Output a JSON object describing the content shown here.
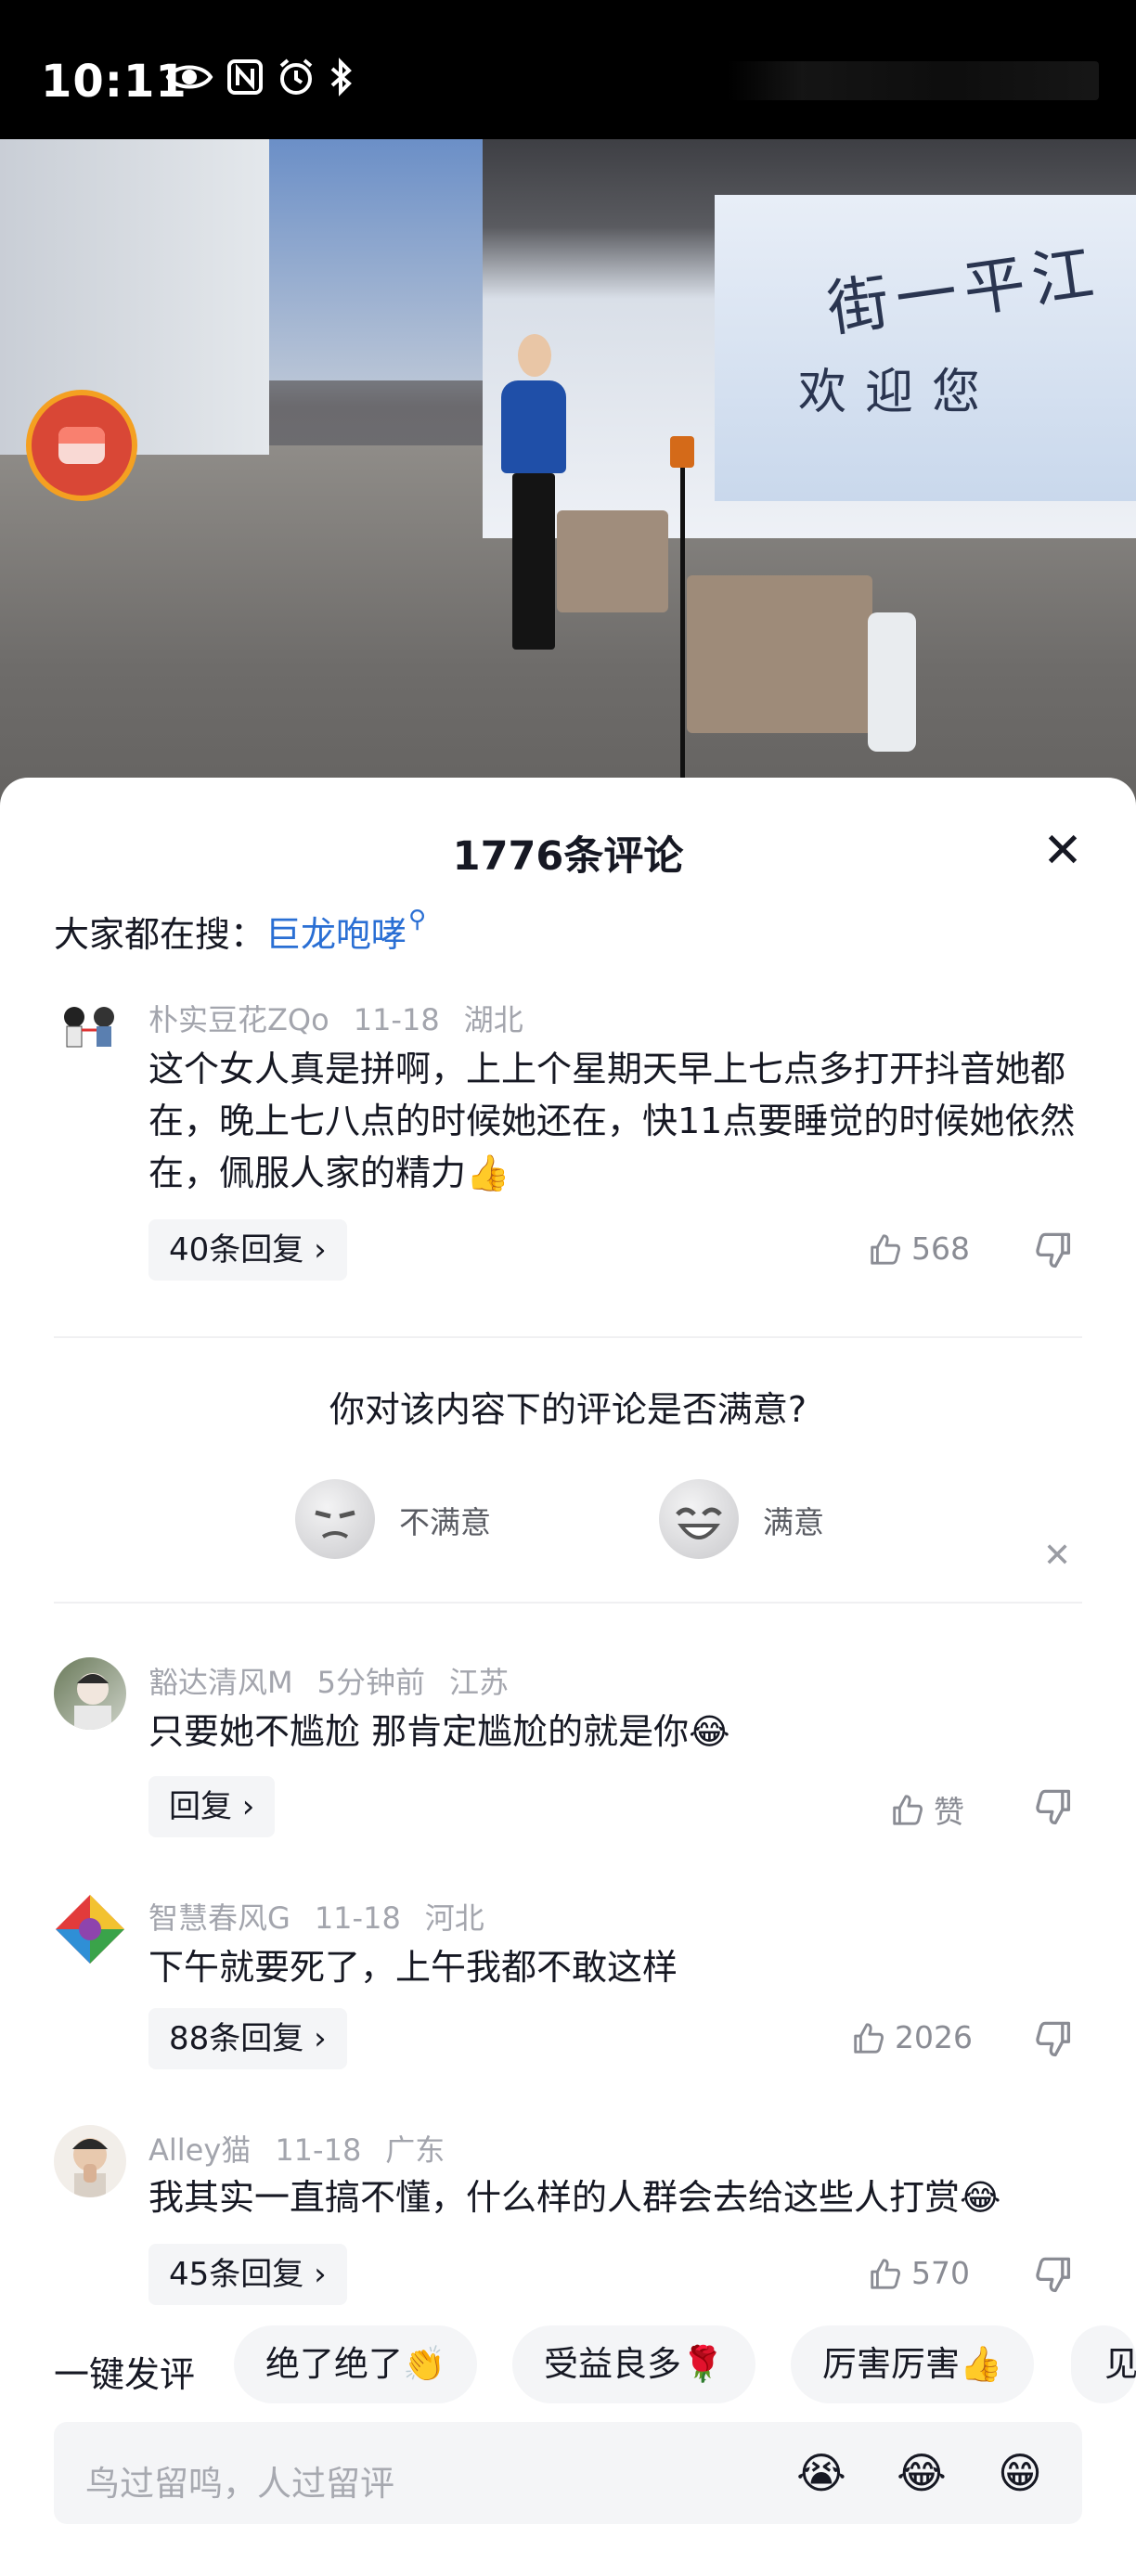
{
  "status_bar": {
    "time": "10:11"
  },
  "video": {
    "sign_text_1": "街一平江",
    "sign_text_2": "欢迎您"
  },
  "comments_panel": {
    "title": "1776条评论",
    "search_prefix": "大家都在搜：",
    "search_keyword": "巨龙咆哮"
  },
  "comments": [
    {
      "user": "朴实豆花ZQo",
      "time": "11-18",
      "location": "湖北",
      "text": "这个女人真是拼啊，上上个星期天早上七点多打开抖音她都在，晚上七八点的时候她还在，快11点要睡觉的时候她依然在，佩服人家的精力👍",
      "replies": "40条回复",
      "likes": "568"
    },
    {
      "user": "豁达清风M",
      "time": "5分钟前",
      "location": "江苏",
      "text": "只要她不尴尬 那肯定尴尬的就是你😂",
      "replies": "回复",
      "likes": "赞"
    },
    {
      "user": "智慧春风G",
      "time": "11-18",
      "location": "河北",
      "text": "下午就要死了，上午我都不敢这样",
      "replies": "88条回复",
      "likes": "2026"
    },
    {
      "user": "Alley猫",
      "time": "11-18",
      "location": "广东",
      "text": "我其实一直搞不懂，什么样的人群会去给这些人打赏😂",
      "replies": "45条回复",
      "likes": "570"
    }
  ],
  "survey": {
    "question": "你对该内容下的评论是否满意?",
    "option_unsatisfied": "不满意",
    "option_satisfied": "满意"
  },
  "quick_reply": {
    "label": "一键发评",
    "chips": [
      "绝了绝了👏",
      "受益良多🌹",
      "厉害厉害👍",
      "见"
    ]
  },
  "input": {
    "placeholder": "鸟过留鸣，人过留评",
    "emojis": [
      "😭",
      "😂",
      "😁"
    ]
  },
  "colors": {
    "accent_link": "#2a6fd4",
    "meta_gray": "#a3a5ad",
    "reply_bg": "#f4f5f7"
  }
}
